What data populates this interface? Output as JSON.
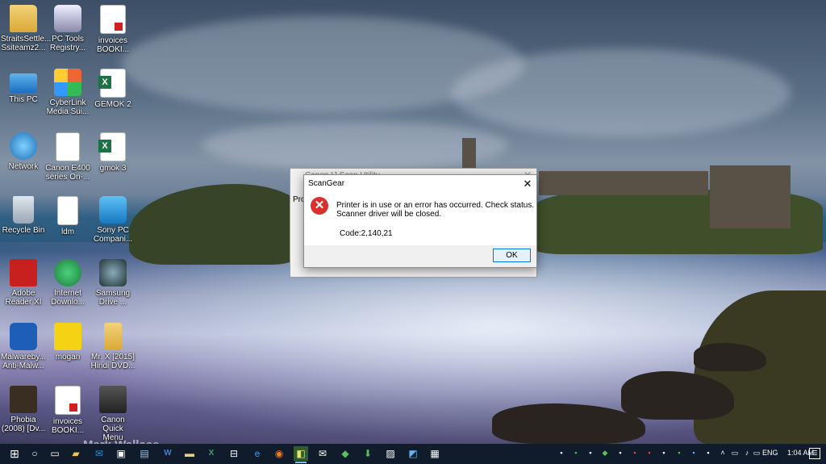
{
  "desktop": {
    "watermark": "Mark Wallace",
    "icons": [
      {
        "label": "StraitsSettle...\nSsiteamz2...",
        "icon": "folder-user-icon"
      },
      {
        "label": "PC Tools\nRegistry...",
        "icon": "registry-app-icon"
      },
      {
        "label": "invoices\nBOOKI...",
        "icon": "pdf-file-icon"
      },
      {
        "label": "This PC",
        "icon": "computer-icon"
      },
      {
        "label": "CyberLink\nMedia Sui...",
        "icon": "cyberlink-icon"
      },
      {
        "label": "GEMOK 2",
        "icon": "excel-file-icon"
      },
      {
        "label": "Network",
        "icon": "network-icon"
      },
      {
        "label": "Canon E400\nseries On-...",
        "icon": "help-document-icon"
      },
      {
        "label": "gmok 3",
        "icon": "excel-file-icon"
      },
      {
        "label": "Recycle Bin",
        "icon": "recycle-bin-icon"
      },
      {
        "label": "ldm",
        "icon": "text-file-icon"
      },
      {
        "label": "Sony PC\nCompani...",
        "icon": "sony-pc-companion-icon"
      },
      {
        "label": "Adobe\nReader XI",
        "icon": "adobe-reader-icon"
      },
      {
        "label": "Internet\nDownlo...",
        "icon": "internet-download-manager-icon"
      },
      {
        "label": "Samsung\nDrive ...",
        "icon": "samsung-drive-icon"
      },
      {
        "label": "Malwareby...\nAnti-Malw...",
        "icon": "malwarebytes-icon"
      },
      {
        "label": "mogan",
        "icon": "image-file-icon"
      },
      {
        "label": "Mr. X [2015]\nHindi DVD...",
        "icon": "folder-icon"
      },
      {
        "label": "Phobia\n(2008) [Dv...",
        "icon": "video-file-icon"
      },
      {
        "label": "invoices\nBOOKI...",
        "icon": "pdf-file-icon"
      },
      {
        "label": "Canon Quick\nMenu",
        "icon": "canon-quick-menu-icon"
      }
    ]
  },
  "background_window": {
    "title": "Canon IJ Scan Utility",
    "partial_label_left": "Proc",
    "partial_label_right": "ear"
  },
  "dialog": {
    "title": "ScanGear",
    "message_line1": "Printer is in use or an error has occurred. Check status.",
    "message_line2": "Scanner driver will be closed.",
    "code": "Code:2,140,21",
    "ok_label": "OK",
    "close_glyph": "✕",
    "error_glyph": "✕"
  },
  "taskbar": {
    "start_glyph": "⊞",
    "search_glyph": "○",
    "language": "ENG",
    "time": "1:04 AM",
    "notification_glyph": "☰"
  }
}
